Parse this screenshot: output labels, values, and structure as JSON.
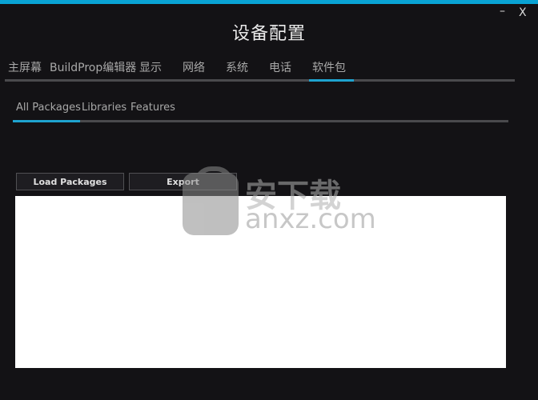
{
  "window": {
    "title": "设备配置",
    "minimize_label": "–",
    "close_label": "X"
  },
  "tabs": [
    {
      "label": "主屏幕"
    },
    {
      "label": "BuildProp编辑器"
    },
    {
      "label": "显示"
    },
    {
      "label": "网络"
    },
    {
      "label": "系统"
    },
    {
      "label": "电话"
    },
    {
      "label": "软件包",
      "active": true
    }
  ],
  "subtabs": [
    {
      "label": "All Packages",
      "active": true
    },
    {
      "label": "Libraries"
    },
    {
      "label": "Features"
    }
  ],
  "buttons": {
    "load": "Load Packages",
    "export": "Export"
  },
  "watermark": {
    "text": "安下载",
    "url": "anxz.com"
  },
  "colors": {
    "accent": "#1ea3cf",
    "background": "#131215"
  }
}
